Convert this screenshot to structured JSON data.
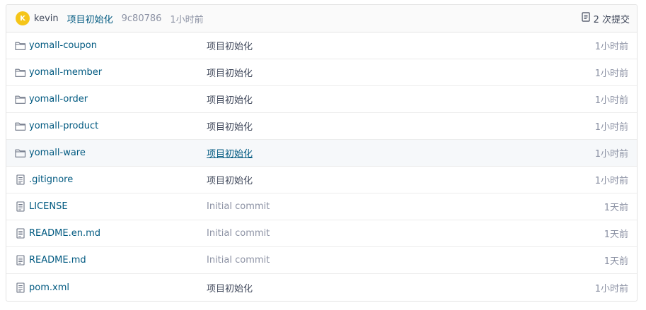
{
  "commit": {
    "avatar_initial": "K",
    "author": "kevin",
    "message": "项目初始化",
    "hash": "9c80786",
    "time": "1小时前",
    "commits_label": "2 次提交"
  },
  "files": [
    {
      "name": "yomall-coupon",
      "type": "folder",
      "message": "项目初始化",
      "time": "1小时前"
    },
    {
      "name": "yomall-member",
      "type": "folder",
      "message": "项目初始化",
      "time": "1小时前"
    },
    {
      "name": "yomall-order",
      "type": "folder",
      "message": "项目初始化",
      "time": "1小时前"
    },
    {
      "name": "yomall-product",
      "type": "folder",
      "message": "项目初始化",
      "time": "1小时前"
    },
    {
      "name": "yomall-ware",
      "type": "folder",
      "message": "项目初始化",
      "time": "1小时前"
    },
    {
      "name": ".gitignore",
      "type": "file",
      "message": "项目初始化",
      "time": "1小时前"
    },
    {
      "name": "LICENSE",
      "type": "file",
      "message": "Initial commit",
      "time": "1天前"
    },
    {
      "name": "README.en.md",
      "type": "file",
      "message": "Initial commit",
      "time": "1天前"
    },
    {
      "name": "README.md",
      "type": "file",
      "message": "Initial commit",
      "time": "1天前"
    },
    {
      "name": "pom.xml",
      "type": "file",
      "message": "项目初始化",
      "time": "1小时前"
    }
  ],
  "icons": {
    "folder": "folder-icon",
    "file": "file-icon",
    "commits": "commits-icon"
  },
  "colors": {
    "link": "#005980",
    "muted": "#8c92a4",
    "avatar": "#f5c518",
    "hover_row": "#f6f8fa"
  }
}
